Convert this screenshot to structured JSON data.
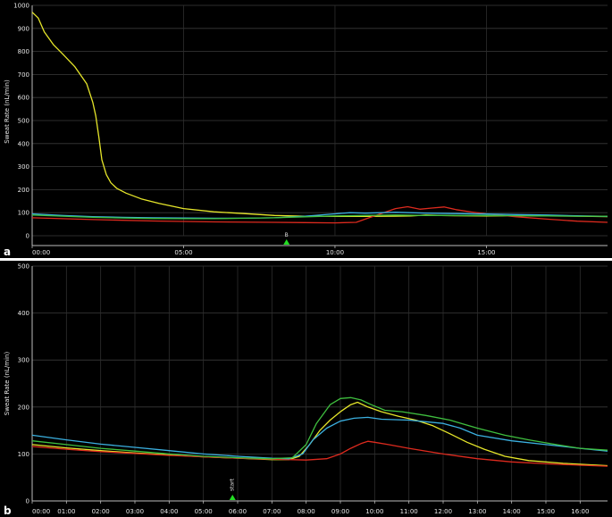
{
  "chart_data": [
    {
      "type": "line",
      "panel_label": "a",
      "ylabel": "Sweat Rate (nL/min)",
      "ylim": [
        0,
        1000
      ],
      "yticks": [
        0,
        100,
        200,
        300,
        400,
        500,
        600,
        700,
        800,
        900,
        1000
      ],
      "xlim": [
        0,
        19
      ],
      "xticks": [
        0,
        5,
        10,
        15
      ],
      "xtick_labels": [
        "00:00",
        "05:00",
        "10:00",
        "15:00"
      ],
      "background": "#000000",
      "grid": true,
      "marker": {
        "x": 8.4,
        "label": "B",
        "color": "#22dd22"
      },
      "series": [
        {
          "color": "#e6e62a",
          "x": [
            0,
            0.2,
            0.4,
            0.7,
            1.0,
            1.4,
            1.8,
            2.0,
            2.1,
            2.2,
            2.3,
            2.45,
            2.6,
            2.8,
            3.1,
            3.6,
            4.2,
            5.0,
            6.0,
            7.0,
            8.0,
            9.0,
            10.0,
            11.0,
            12.0,
            12.5,
            13.0,
            13.5,
            14.0,
            15.0,
            16.0,
            17.0,
            18.0,
            19.0
          ],
          "y": [
            970,
            945,
            885,
            830,
            790,
            735,
            660,
            580,
            520,
            430,
            330,
            265,
            230,
            205,
            185,
            160,
            140,
            118,
            104,
            96,
            88,
            85,
            84,
            84,
            85,
            86,
            90,
            88,
            87,
            86,
            87,
            86,
            85,
            83
          ]
        },
        {
          "color": "#dd2a1e",
          "x": [
            0,
            2,
            4,
            6,
            8,
            9,
            10,
            10.7,
            11.0,
            11.5,
            12.0,
            12.4,
            12.8,
            13.2,
            13.6,
            14,
            14.5,
            15,
            16,
            17,
            18,
            19
          ],
          "y": [
            78,
            70,
            64,
            60,
            58,
            57,
            56,
            58,
            72,
            95,
            118,
            126,
            115,
            120,
            125,
            113,
            103,
            95,
            82,
            72,
            63,
            58
          ]
        },
        {
          "color": "#3bb0e0",
          "x": [
            0,
            1,
            2,
            3,
            4,
            5,
            6,
            7,
            8,
            9,
            10,
            10.5,
            11,
            11.5,
            12,
            13,
            14,
            15,
            16,
            17,
            18,
            19
          ],
          "y": [
            95,
            88,
            83,
            80,
            78,
            77,
            76,
            76,
            78,
            85,
            95,
            100,
            98,
            100,
            102,
            98,
            96,
            94,
            92,
            90,
            87,
            84
          ]
        },
        {
          "color": "#3fbf3f",
          "x": [
            0,
            1,
            2,
            3,
            4,
            5,
            6,
            7,
            8,
            9,
            10,
            11,
            12,
            13,
            14,
            15,
            16,
            17,
            18,
            19
          ],
          "y": [
            90,
            85,
            80,
            77,
            75,
            74,
            74,
            76,
            78,
            82,
            86,
            88,
            90,
            88,
            88,
            88,
            87,
            86,
            85,
            85
          ]
        }
      ]
    },
    {
      "type": "line",
      "panel_label": "b",
      "ylabel": "Sweat Rate (nL/min)",
      "ylim": [
        0,
        500
      ],
      "yticks": [
        0,
        100,
        200,
        300,
        400,
        500
      ],
      "xlim": [
        0,
        16.8
      ],
      "xticks": [
        0,
        1,
        2,
        3,
        4,
        5,
        6,
        7,
        8,
        9,
        10,
        11,
        12,
        13,
        14,
        15,
        16
      ],
      "xtick_labels": [
        "00:00",
        "01:00",
        "02:00",
        "03:00",
        "04:00",
        "05:00",
        "06:00",
        "07:00",
        "08:00",
        "09:00",
        "10:00",
        "11:00",
        "12:00",
        "13:00",
        "14:00",
        "15:00",
        "16:00"
      ],
      "background": "#000000",
      "grid": true,
      "marker": {
        "x": 5.85,
        "label": "start",
        "color": "#22dd22"
      },
      "series": [
        {
          "color": "#e6e62a",
          "x": [
            0,
            1,
            2,
            3,
            4,
            5,
            6,
            7,
            7.5,
            7.8,
            8.1,
            8.4,
            8.7,
            9.0,
            9.3,
            9.5,
            9.8,
            10.2,
            10.7,
            11.2,
            11.7,
            12.2,
            12.7,
            13.2,
            13.8,
            14.5,
            15.5,
            16.8
          ],
          "y": [
            120,
            113,
            107,
            102,
            98,
            94,
            91,
            88,
            88,
            95,
            120,
            150,
            172,
            190,
            205,
            210,
            200,
            190,
            180,
            172,
            160,
            143,
            125,
            110,
            95,
            86,
            80,
            75
          ]
        },
        {
          "color": "#dd2a1e",
          "x": [
            0,
            1,
            2,
            3,
            4,
            5,
            6,
            7,
            8,
            8.6,
            9.0,
            9.3,
            9.6,
            9.8,
            10.0,
            10.4,
            11,
            12,
            13,
            14,
            15,
            16,
            16.8
          ],
          "y": [
            116,
            110,
            105,
            101,
            97,
            94,
            91,
            89,
            87,
            90,
            100,
            112,
            122,
            127,
            125,
            120,
            112,
            100,
            90,
            83,
            79,
            76,
            74
          ]
        },
        {
          "color": "#3bb0e0",
          "x": [
            0,
            1,
            2,
            3,
            4,
            5,
            6,
            7,
            7.5,
            7.9,
            8.2,
            8.6,
            9.0,
            9.4,
            9.8,
            10.2,
            11,
            12,
            12.5,
            13,
            14,
            15,
            16,
            16.8
          ],
          "y": [
            140,
            130,
            121,
            114,
            107,
            100,
            95,
            91,
            90,
            100,
            130,
            155,
            170,
            176,
            178,
            174,
            172,
            165,
            155,
            140,
            128,
            120,
            112,
            106
          ]
        },
        {
          "color": "#3fbf3f",
          "x": [
            0,
            1,
            2,
            3,
            4,
            5,
            6,
            7,
            7.6,
            8.0,
            8.3,
            8.7,
            9.0,
            9.3,
            9.6,
            9.9,
            10.3,
            10.8,
            11.5,
            12.2,
            13,
            13.8,
            14.5,
            15.3,
            16,
            16.8
          ],
          "y": [
            128,
            120,
            112,
            106,
            100,
            95,
            92,
            90,
            92,
            120,
            165,
            205,
            218,
            220,
            215,
            205,
            193,
            190,
            182,
            172,
            155,
            140,
            130,
            120,
            112,
            108
          ]
        }
      ]
    }
  ]
}
